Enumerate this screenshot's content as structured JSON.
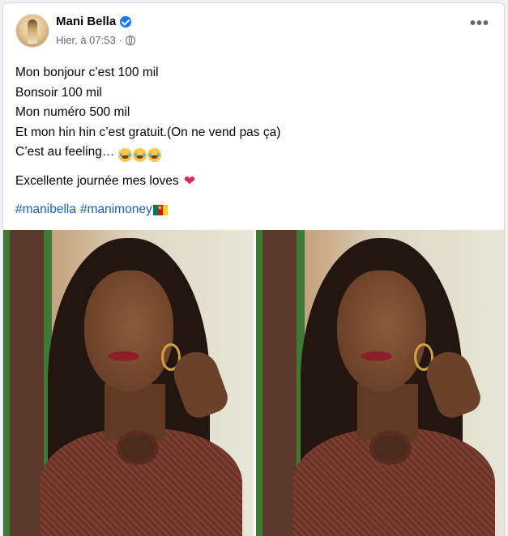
{
  "post": {
    "author": "Mani Bella",
    "timestamp": "Hier, à 07:53",
    "privacy_icon": "globe-icon",
    "more_label": "•••",
    "lines": [
      "Mon bonjour c’est 100 mil",
      "Bonsoir 100 mil",
      "Mon numéro 500 mil",
      "Et mon hin hin c’est gratuit.(On ne vend pas ça)",
      "C’est au feeling…"
    ],
    "emojis": [
      "😂",
      "😂",
      "😂"
    ],
    "greeting": "Excellente journée mes loves",
    "hashtags": [
      "#manibella",
      "#manimoney"
    ],
    "colors": {
      "hashtag": "#1b5fbf",
      "verified": "#1877f2",
      "meta": "#65676b"
    }
  }
}
